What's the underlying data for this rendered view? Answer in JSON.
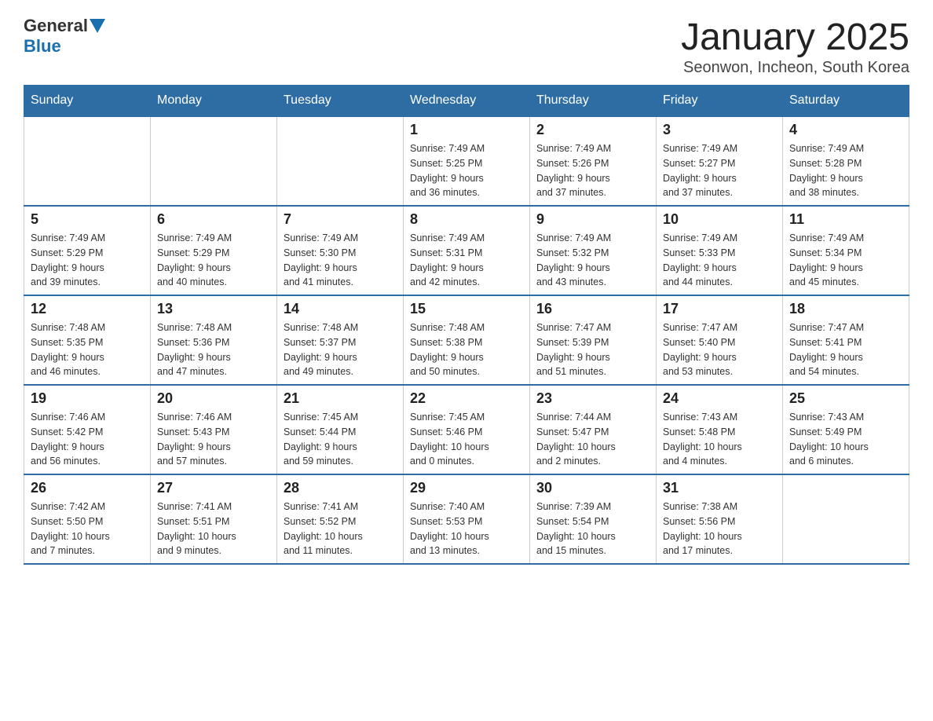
{
  "logo": {
    "general": "General",
    "blue": "Blue"
  },
  "title": "January 2025",
  "subtitle": "Seonwon, Incheon, South Korea",
  "days_of_week": [
    "Sunday",
    "Monday",
    "Tuesday",
    "Wednesday",
    "Thursday",
    "Friday",
    "Saturday"
  ],
  "weeks": [
    [
      {
        "day": "",
        "info": ""
      },
      {
        "day": "",
        "info": ""
      },
      {
        "day": "",
        "info": ""
      },
      {
        "day": "1",
        "info": "Sunrise: 7:49 AM\nSunset: 5:25 PM\nDaylight: 9 hours\nand 36 minutes."
      },
      {
        "day": "2",
        "info": "Sunrise: 7:49 AM\nSunset: 5:26 PM\nDaylight: 9 hours\nand 37 minutes."
      },
      {
        "day": "3",
        "info": "Sunrise: 7:49 AM\nSunset: 5:27 PM\nDaylight: 9 hours\nand 37 minutes."
      },
      {
        "day": "4",
        "info": "Sunrise: 7:49 AM\nSunset: 5:28 PM\nDaylight: 9 hours\nand 38 minutes."
      }
    ],
    [
      {
        "day": "5",
        "info": "Sunrise: 7:49 AM\nSunset: 5:29 PM\nDaylight: 9 hours\nand 39 minutes."
      },
      {
        "day": "6",
        "info": "Sunrise: 7:49 AM\nSunset: 5:29 PM\nDaylight: 9 hours\nand 40 minutes."
      },
      {
        "day": "7",
        "info": "Sunrise: 7:49 AM\nSunset: 5:30 PM\nDaylight: 9 hours\nand 41 minutes."
      },
      {
        "day": "8",
        "info": "Sunrise: 7:49 AM\nSunset: 5:31 PM\nDaylight: 9 hours\nand 42 minutes."
      },
      {
        "day": "9",
        "info": "Sunrise: 7:49 AM\nSunset: 5:32 PM\nDaylight: 9 hours\nand 43 minutes."
      },
      {
        "day": "10",
        "info": "Sunrise: 7:49 AM\nSunset: 5:33 PM\nDaylight: 9 hours\nand 44 minutes."
      },
      {
        "day": "11",
        "info": "Sunrise: 7:49 AM\nSunset: 5:34 PM\nDaylight: 9 hours\nand 45 minutes."
      }
    ],
    [
      {
        "day": "12",
        "info": "Sunrise: 7:48 AM\nSunset: 5:35 PM\nDaylight: 9 hours\nand 46 minutes."
      },
      {
        "day": "13",
        "info": "Sunrise: 7:48 AM\nSunset: 5:36 PM\nDaylight: 9 hours\nand 47 minutes."
      },
      {
        "day": "14",
        "info": "Sunrise: 7:48 AM\nSunset: 5:37 PM\nDaylight: 9 hours\nand 49 minutes."
      },
      {
        "day": "15",
        "info": "Sunrise: 7:48 AM\nSunset: 5:38 PM\nDaylight: 9 hours\nand 50 minutes."
      },
      {
        "day": "16",
        "info": "Sunrise: 7:47 AM\nSunset: 5:39 PM\nDaylight: 9 hours\nand 51 minutes."
      },
      {
        "day": "17",
        "info": "Sunrise: 7:47 AM\nSunset: 5:40 PM\nDaylight: 9 hours\nand 53 minutes."
      },
      {
        "day": "18",
        "info": "Sunrise: 7:47 AM\nSunset: 5:41 PM\nDaylight: 9 hours\nand 54 minutes."
      }
    ],
    [
      {
        "day": "19",
        "info": "Sunrise: 7:46 AM\nSunset: 5:42 PM\nDaylight: 9 hours\nand 56 minutes."
      },
      {
        "day": "20",
        "info": "Sunrise: 7:46 AM\nSunset: 5:43 PM\nDaylight: 9 hours\nand 57 minutes."
      },
      {
        "day": "21",
        "info": "Sunrise: 7:45 AM\nSunset: 5:44 PM\nDaylight: 9 hours\nand 59 minutes."
      },
      {
        "day": "22",
        "info": "Sunrise: 7:45 AM\nSunset: 5:46 PM\nDaylight: 10 hours\nand 0 minutes."
      },
      {
        "day": "23",
        "info": "Sunrise: 7:44 AM\nSunset: 5:47 PM\nDaylight: 10 hours\nand 2 minutes."
      },
      {
        "day": "24",
        "info": "Sunrise: 7:43 AM\nSunset: 5:48 PM\nDaylight: 10 hours\nand 4 minutes."
      },
      {
        "day": "25",
        "info": "Sunrise: 7:43 AM\nSunset: 5:49 PM\nDaylight: 10 hours\nand 6 minutes."
      }
    ],
    [
      {
        "day": "26",
        "info": "Sunrise: 7:42 AM\nSunset: 5:50 PM\nDaylight: 10 hours\nand 7 minutes."
      },
      {
        "day": "27",
        "info": "Sunrise: 7:41 AM\nSunset: 5:51 PM\nDaylight: 10 hours\nand 9 minutes."
      },
      {
        "day": "28",
        "info": "Sunrise: 7:41 AM\nSunset: 5:52 PM\nDaylight: 10 hours\nand 11 minutes."
      },
      {
        "day": "29",
        "info": "Sunrise: 7:40 AM\nSunset: 5:53 PM\nDaylight: 10 hours\nand 13 minutes."
      },
      {
        "day": "30",
        "info": "Sunrise: 7:39 AM\nSunset: 5:54 PM\nDaylight: 10 hours\nand 15 minutes."
      },
      {
        "day": "31",
        "info": "Sunrise: 7:38 AM\nSunset: 5:56 PM\nDaylight: 10 hours\nand 17 minutes."
      },
      {
        "day": "",
        "info": ""
      }
    ]
  ]
}
